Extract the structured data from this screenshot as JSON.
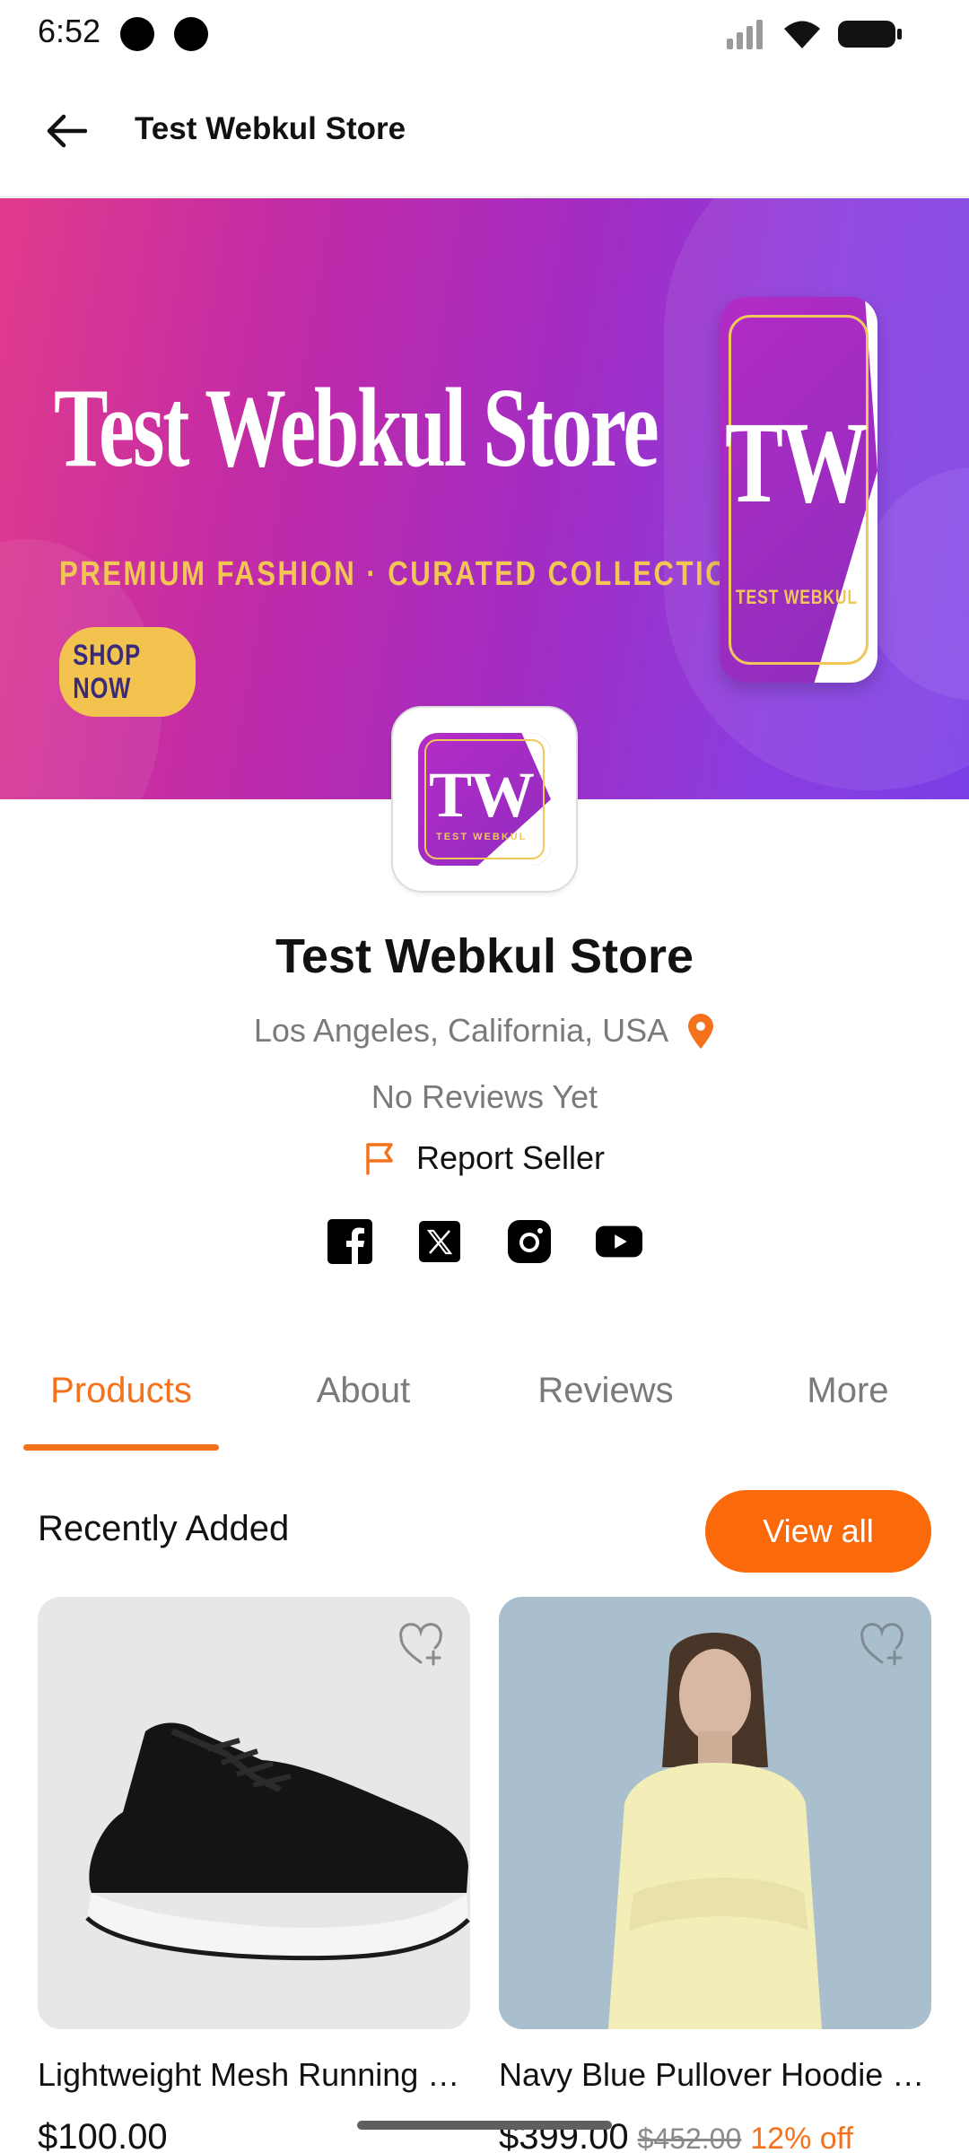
{
  "status_bar": {
    "time": "6:52"
  },
  "app_bar": {
    "title": "Test Webkul Store"
  },
  "banner": {
    "title": "Test Webkul Store",
    "tagline": "PREMIUM FASHION  ·  CURATED COLLECTIONS",
    "cta": "SHOP NOW",
    "logo_text": "TW",
    "logo_sub": "TEST WEBKUL"
  },
  "store": {
    "logo_text": "TW",
    "logo_sub": "TEST WEBKUL",
    "name": "Test Webkul Store",
    "location": "Los Angeles, California, USA",
    "reviews": "No Reviews Yet",
    "report": "Report Seller",
    "socials": [
      "facebook-icon",
      "x-icon",
      "instagram-icon",
      "youtube-icon"
    ]
  },
  "tabs": [
    {
      "label": "Products",
      "active": true
    },
    {
      "label": "About",
      "active": false
    },
    {
      "label": "Reviews",
      "active": false
    },
    {
      "label": "More",
      "active": false
    }
  ],
  "recently_added": {
    "title": "Recently Added",
    "view_all": "View all",
    "products": [
      {
        "name": "Lightweight Mesh Running Sneakers",
        "price": "$100.00",
        "old_price": "",
        "discount": ""
      },
      {
        "name": "Navy Blue Pullover Hoodie for Men",
        "price": "$399.00",
        "old_price": "$452.00",
        "discount": "12% off"
      }
    ]
  },
  "colors": {
    "accent": "#f4721b",
    "button": "#fa6a0a",
    "banner_start": "#e13b8c",
    "banner_end": "#7b3fe6"
  }
}
